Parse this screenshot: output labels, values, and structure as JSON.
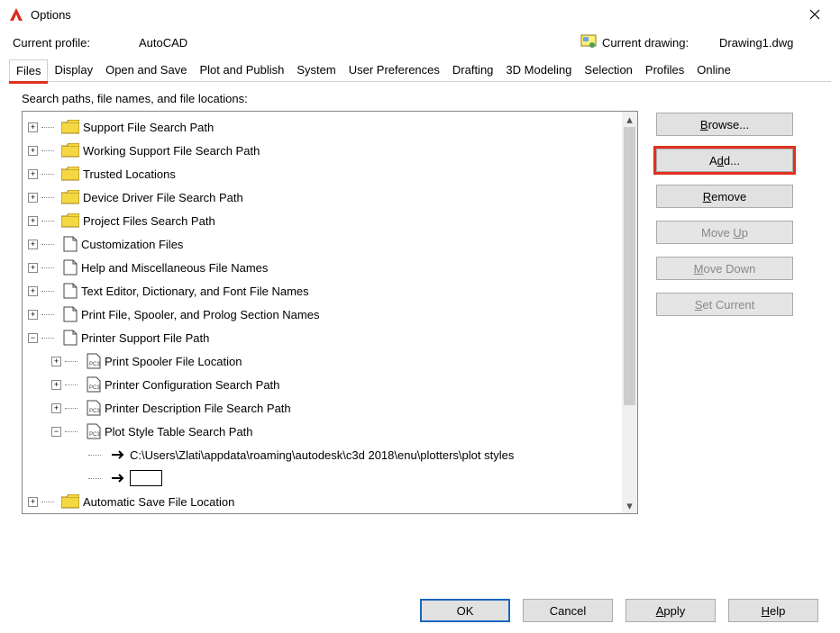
{
  "window": {
    "title": "Options"
  },
  "profile": {
    "current_label": "Current profile:",
    "current_value": "AutoCAD",
    "drawing_label": "Current drawing:",
    "drawing_value": "Drawing1.dwg"
  },
  "tabs": {
    "files": "Files",
    "display": "Display",
    "open_save": "Open and Save",
    "plot": "Plot and Publish",
    "system": "System",
    "user_prefs": "User Preferences",
    "drafting": "Drafting",
    "modeling": "3D Modeling",
    "selection": "Selection",
    "profiles": "Profiles",
    "online": "Online"
  },
  "panel": {
    "heading": "Search paths, file names, and file locations:"
  },
  "tree": {
    "support": "Support File Search Path",
    "working": "Working Support File Search Path",
    "trusted": "Trusted Locations",
    "device": "Device Driver File Search Path",
    "project": "Project Files Search Path",
    "custom": "Customization Files",
    "help": "Help and Miscellaneous File Names",
    "dict": "Text Editor, Dictionary, and Font File Names",
    "print": "Print File, Spooler, and Prolog Section Names",
    "printer": "Printer Support File Path",
    "printer_children": {
      "spooler": "Print Spooler File Location",
      "config": "Printer Configuration Search Path",
      "desc": "Printer Description File Search Path",
      "plot": "Plot Style Table Search Path",
      "plot_path": "C:\\Users\\Zlati\\appdata\\roaming\\autodesk\\c3d 2018\\enu\\plotters\\plot styles"
    },
    "autosave": "Automatic Save File Location"
  },
  "buttons": {
    "browse": "Browse...",
    "add": "Add...",
    "remove": "Remove",
    "moveup": "Move Up",
    "movedown": "Move Down",
    "setcurrent": "Set Current"
  },
  "footer": {
    "ok": "OK",
    "cancel": "Cancel",
    "apply": "Apply",
    "help": "Help"
  }
}
